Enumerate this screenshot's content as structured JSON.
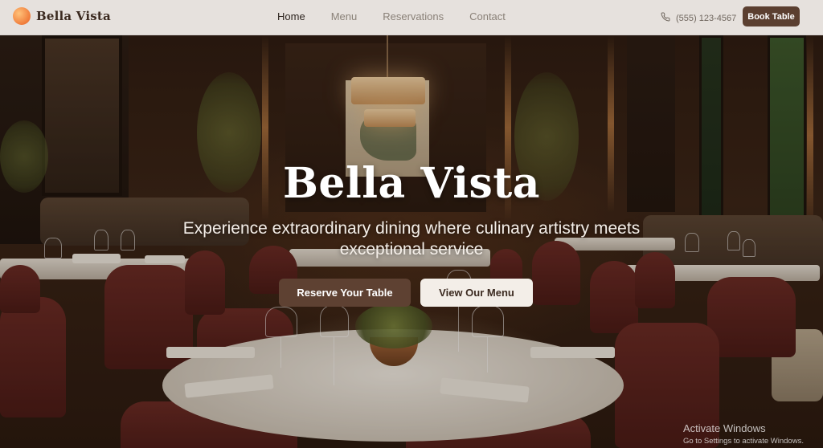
{
  "brand": {
    "name": "Bella Vista",
    "logo_icon": "sunset-gradient-circle-icon"
  },
  "nav": {
    "items": [
      {
        "label": "Home",
        "active": true
      },
      {
        "label": "Menu",
        "active": false
      },
      {
        "label": "Reservations",
        "active": false
      },
      {
        "label": "Contact",
        "active": false
      }
    ]
  },
  "contact": {
    "phone_icon": "phone-icon",
    "phone": "(555) 123-4567"
  },
  "header_button": {
    "label": "Book Table"
  },
  "hero": {
    "title": "Bella Vista",
    "subtitle": "Experience extraordinary dining where culinary artistry meets exceptional service",
    "primary_cta": "Reserve Your Table",
    "secondary_cta": "View Our Menu"
  },
  "watermark": {
    "title": "Activate Windows",
    "subtitle": "Go to Settings to activate Windows."
  },
  "colors": {
    "accent": "#5b3f30",
    "header_bg": "#ece8e4",
    "secondary_button_bg": "#f3eee8",
    "logo_gradient": [
      "#ffc27a",
      "#f07c3a"
    ]
  }
}
